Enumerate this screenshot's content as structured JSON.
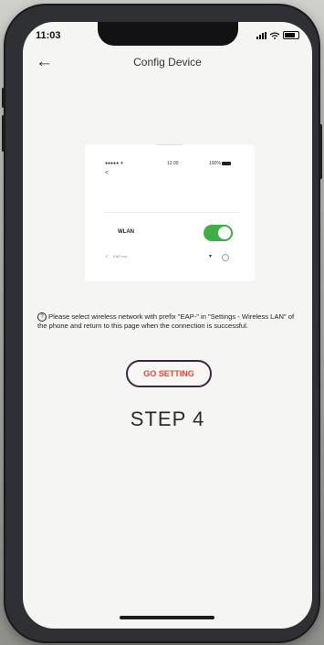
{
  "status_bar": {
    "time": "11:03"
  },
  "nav": {
    "back_icon": "←",
    "title": "Config Device"
  },
  "preview": {
    "signal_text": "●●●●● ✈",
    "time": "12:00",
    "battery_text": "100%",
    "back_icon": "<",
    "wlan_label": "WLAN",
    "wlan_enabled": true,
    "network_name": "EAP-xxx"
  },
  "instructions": {
    "icon": "?",
    "text": "Please select wireless network with prefix \"EAP-\" in \"Settings - Wireless LAN\" of the phone and return to this page when the connection is successful."
  },
  "go_setting_label": "GO SETTING",
  "step_label": "STEP 4",
  "colors": {
    "toggle_on": "#3fae46",
    "button_text": "#d9483d",
    "button_border": "#3b2745"
  }
}
